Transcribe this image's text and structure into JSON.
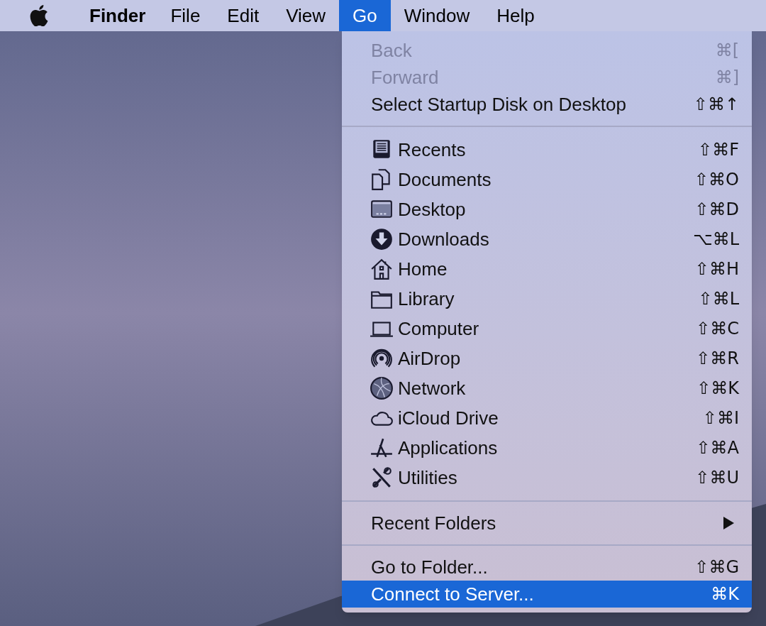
{
  "menu_bar": {
    "app_name": "Finder",
    "menus": [
      {
        "label": "File",
        "selected": false
      },
      {
        "label": "Edit",
        "selected": false
      },
      {
        "label": "View",
        "selected": false
      },
      {
        "label": "Go",
        "selected": true
      },
      {
        "label": "Window",
        "selected": false
      },
      {
        "label": "Help",
        "selected": false
      }
    ]
  },
  "menu": {
    "items": [
      {
        "kind": "item",
        "label": "Back",
        "shortcut": "⌘[",
        "disabled": true,
        "selected": false
      },
      {
        "kind": "item",
        "label": "Forward",
        "shortcut": "⌘]",
        "disabled": true,
        "selected": false
      },
      {
        "kind": "item",
        "label": "Select Startup Disk on Desktop",
        "shortcut": "⇧⌘↑",
        "disabled": false,
        "selected": false
      },
      {
        "kind": "separator"
      },
      {
        "kind": "place",
        "label": "Recents",
        "shortcut": "⇧⌘F",
        "disabled": false,
        "selected": false
      },
      {
        "kind": "place",
        "label": "Documents",
        "shortcut": "⇧⌘O",
        "disabled": false,
        "selected": false
      },
      {
        "kind": "place",
        "label": "Desktop",
        "shortcut": "⇧⌘D",
        "disabled": false,
        "selected": false
      },
      {
        "kind": "place",
        "label": "Downloads",
        "shortcut": "⌥⌘L",
        "disabled": false,
        "selected": false
      },
      {
        "kind": "place",
        "label": "Home",
        "shortcut": "⇧⌘H",
        "disabled": false,
        "selected": false
      },
      {
        "kind": "place",
        "label": "Library",
        "shortcut": "⇧⌘L",
        "disabled": false,
        "selected": false
      },
      {
        "kind": "place",
        "label": "Computer",
        "shortcut": "⇧⌘C",
        "disabled": false,
        "selected": false
      },
      {
        "kind": "place",
        "label": "AirDrop",
        "shortcut": "⇧⌘R",
        "disabled": false,
        "selected": false
      },
      {
        "kind": "place",
        "label": "Network",
        "shortcut": "⇧⌘K",
        "disabled": false,
        "selected": false
      },
      {
        "kind": "place",
        "label": "iCloud Drive",
        "shortcut": "⇧⌘I",
        "disabled": false,
        "selected": false
      },
      {
        "kind": "place",
        "label": "Applications",
        "shortcut": "⇧⌘A",
        "disabled": false,
        "selected": false
      },
      {
        "kind": "place",
        "label": "Utilities",
        "shortcut": "⇧⌘U",
        "disabled": false,
        "selected": false
      },
      {
        "kind": "separator"
      },
      {
        "kind": "submenu",
        "label": "Recent Folders",
        "disabled": false,
        "selected": false
      },
      {
        "kind": "separator"
      },
      {
        "kind": "item",
        "label": "Go to Folder...",
        "shortcut": "⇧⌘G",
        "disabled": false,
        "selected": false
      },
      {
        "kind": "item",
        "label": "Connect to Server...",
        "shortcut": "⌘K",
        "disabled": false,
        "selected": true
      }
    ]
  }
}
